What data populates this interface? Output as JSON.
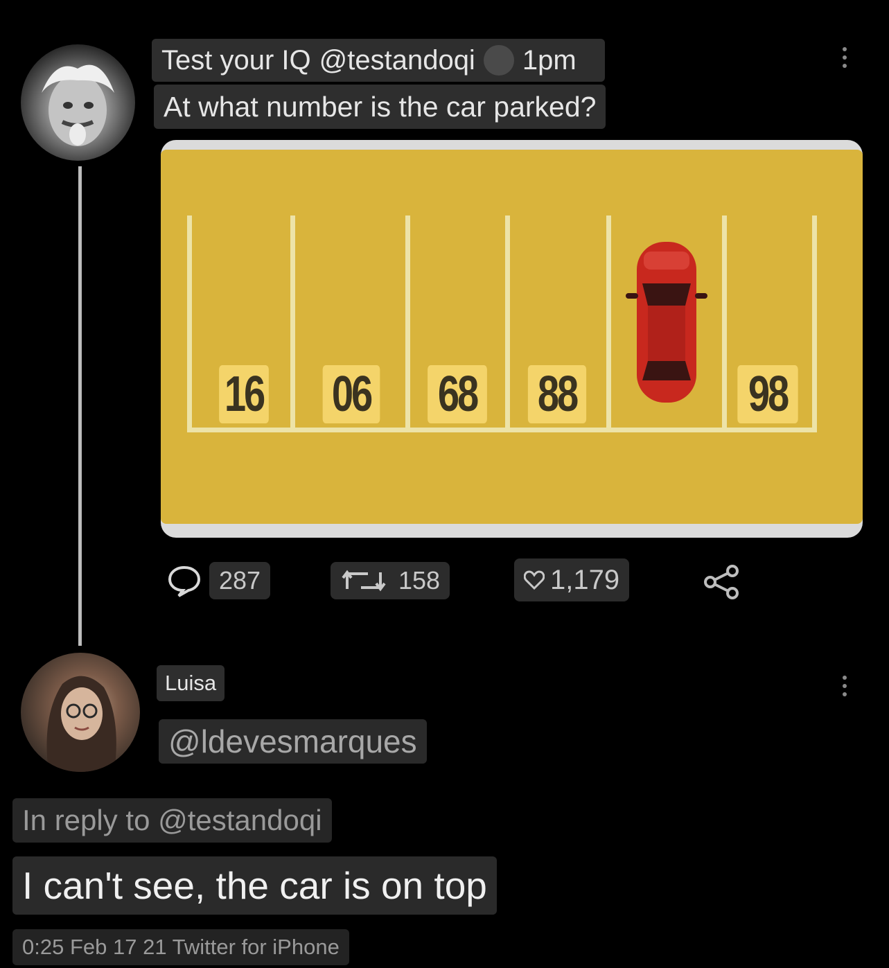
{
  "tweet": {
    "author_name": "Test your IQ",
    "author_handle": "@testandoqi",
    "time": "1pm",
    "text": "At what number is the car parked?",
    "parking_numbers": [
      "16",
      "06",
      "68",
      "88",
      "98"
    ],
    "actions": {
      "replies": "287",
      "retweets": "158",
      "likes": "1,179"
    },
    "colors": {
      "lot_yellow": "#d9b43c",
      "plate_yellow": "#f4d46a",
      "car_red": "#c8281e"
    }
  },
  "reply": {
    "author_name": "Luisa",
    "author_handle": "@ldevesmarques",
    "in_reply_to": "In reply to @testandoqi",
    "text": "I can't see, the car is on top",
    "meta": "0:25 Feb 17 21 Twitter for iPhone"
  }
}
